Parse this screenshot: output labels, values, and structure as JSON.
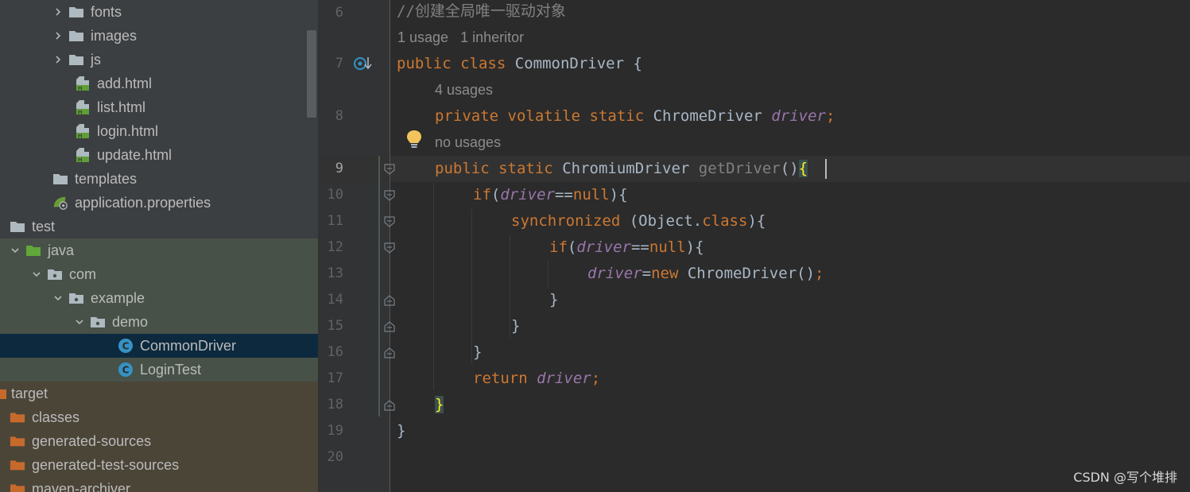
{
  "project_tree": {
    "items": [
      {
        "label": "fonts",
        "kind": "folder"
      },
      {
        "label": "images",
        "kind": "folder"
      },
      {
        "label": "js",
        "kind": "folder"
      },
      {
        "label": "add.html",
        "kind": "html"
      },
      {
        "label": "list.html",
        "kind": "html"
      },
      {
        "label": "login.html",
        "kind": "html"
      },
      {
        "label": "update.html",
        "kind": "html"
      },
      {
        "label": "templates",
        "kind": "folder"
      },
      {
        "label": "application.properties",
        "kind": "properties"
      },
      {
        "label": "test",
        "kind": "folder"
      },
      {
        "label": "java",
        "kind": "source-folder"
      },
      {
        "label": "com",
        "kind": "package"
      },
      {
        "label": "example",
        "kind": "package"
      },
      {
        "label": "demo",
        "kind": "package"
      },
      {
        "label": "CommonDriver",
        "kind": "class",
        "selected": true
      },
      {
        "label": "LoginTest",
        "kind": "class"
      },
      {
        "label": "target",
        "kind": "excluded-folder"
      },
      {
        "label": "classes",
        "kind": "excluded-folder"
      },
      {
        "label": "generated-sources",
        "kind": "excluded-folder"
      },
      {
        "label": "generated-test-sources",
        "kind": "excluded-folder"
      },
      {
        "label": "maven-archiver",
        "kind": "excluded-folder"
      }
    ]
  },
  "editor": {
    "line_numbers": [
      "6",
      "7",
      "8",
      "9",
      "10",
      "11",
      "12",
      "13",
      "14",
      "15",
      "16",
      "17",
      "18",
      "19",
      "20"
    ],
    "hints": {
      "class_usages": "1 usage",
      "class_inheritors": "1 inheritor",
      "field_usages": "4 usages",
      "method_usages": "no usages"
    },
    "code": {
      "l6_comment": "//创建全局唯一驱动对象",
      "l7_public": "public",
      "l7_class": "class",
      "l7_name": "CommonDriver {",
      "l8_private": "private",
      "l8_volatile": "volatile",
      "l8_static": "static",
      "l8_type": "ChromeDriver",
      "l8_field": "driver",
      "l8_semi": ";",
      "l9_public": "public",
      "l9_static": "static",
      "l9_type": "ChromiumDriver",
      "l9_method": "getDriver",
      "l9_parens": "()",
      "l9_brace": "{",
      "l10_if": "if",
      "l10_open": "(",
      "l10_field": "driver",
      "l10_op": "==",
      "l10_null": "null",
      "l10_close": "){",
      "l11_sync": "synchronized",
      "l11_open": " (Object.",
      "l11_class": "class",
      "l11_close": "){",
      "l12_if": "if",
      "l12_open": "(",
      "l12_field": "driver",
      "l12_op": "==",
      "l12_null": "null",
      "l12_close": "){",
      "l13_field": "driver",
      "l13_op": "=",
      "l13_new": "new",
      "l13_rest": " ChromeDriver()",
      "l13_semi": ";",
      "l14": "}",
      "l15": "}",
      "l16": "}",
      "l17_return": "return",
      "l17_field": "driver",
      "l17_semi": ";",
      "l18": "}",
      "l19": "}"
    }
  },
  "watermark": "CSDN @写个堆排",
  "colors": {
    "keyword": "#cc7832",
    "field": "#9876aa",
    "text": "#a9b7c6",
    "comment": "#808080",
    "selection": "#0d293e"
  }
}
